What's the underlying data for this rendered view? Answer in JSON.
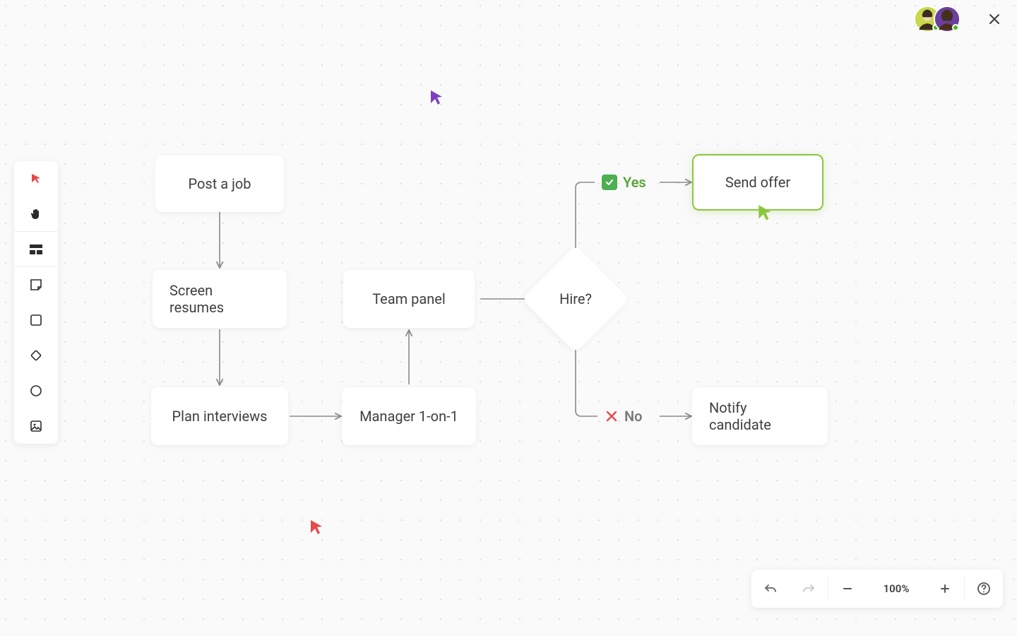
{
  "header": {
    "collaborators": [
      {
        "name": "collaborator-1",
        "bg": "#c7d84a"
      },
      {
        "name": "collaborator-2",
        "bg": "#6b3fa0"
      }
    ]
  },
  "toolbar": {
    "tools": [
      {
        "name": "select",
        "active": true
      },
      {
        "name": "hand"
      },
      {
        "name": "section"
      },
      {
        "name": "sticky"
      },
      {
        "name": "rectangle"
      },
      {
        "name": "diamond"
      },
      {
        "name": "ellipse"
      },
      {
        "name": "image"
      }
    ]
  },
  "diagram": {
    "nodes": {
      "post_job": {
        "label": "Post a job"
      },
      "screen_resumes": {
        "label": "Screen resumes"
      },
      "plan_interviews": {
        "label": "Plan interviews"
      },
      "manager_1on1": {
        "label": "Manager 1-on-1"
      },
      "team_panel": {
        "label": "Team panel"
      },
      "hire": {
        "label": "Hire?"
      },
      "send_offer": {
        "label": "Send offer",
        "selected": true
      },
      "notify": {
        "label": "Notify candidate"
      }
    },
    "branches": {
      "yes": {
        "label": "Yes"
      },
      "no": {
        "label": "No"
      }
    },
    "cursors": {
      "purple": {
        "color": "#7e3fbf"
      },
      "red": {
        "color": "#e64a4a"
      },
      "green": {
        "color": "#8cc63f"
      }
    }
  },
  "bottombar": {
    "zoom": "100%"
  },
  "colors": {
    "accent_green": "#8cc63f",
    "accent_red": "#e64a4a",
    "edge": "#8a8a8a"
  }
}
